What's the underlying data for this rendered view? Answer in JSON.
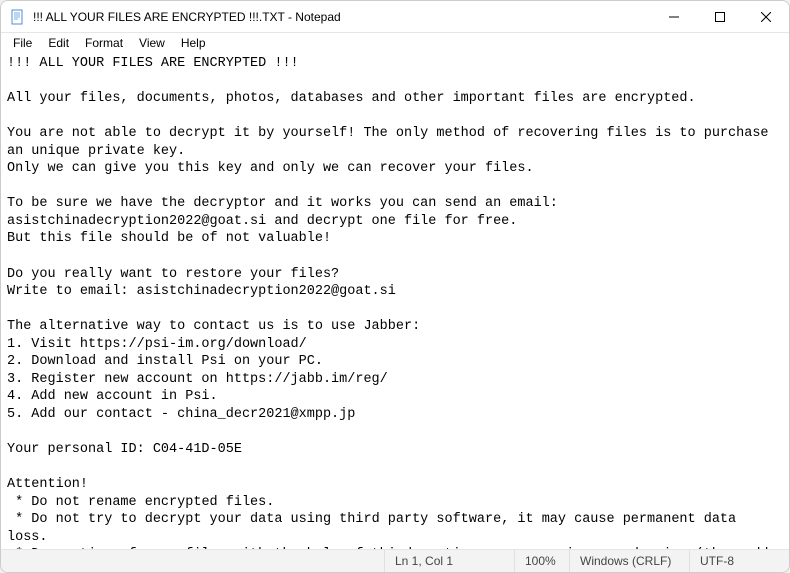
{
  "titlebar": {
    "title": "!!! ALL YOUR FILES ARE ENCRYPTED !!!.TXT - Notepad",
    "icon": "notepad-icon"
  },
  "menubar": {
    "file": "File",
    "edit": "Edit",
    "format": "Format",
    "view": "View",
    "help": "Help"
  },
  "content": {
    "text": "!!! ALL YOUR FILES ARE ENCRYPTED !!!\n\nAll your files, documents, photos, databases and other important files are encrypted.\n\nYou are not able to decrypt it by yourself! The only method of recovering files is to purchase an unique private key.\nOnly we can give you this key and only we can recover your files.\n\nTo be sure we have the decryptor and it works you can send an email: asistchinadecryption2022@goat.si and decrypt one file for free.\nBut this file should be of not valuable!\n\nDo you really want to restore your files?\nWrite to email: asistchinadecryption2022@goat.si\n\nThe alternative way to contact us is to use Jabber:\n1. Visit https://psi-im.org/download/\n2. Download and install Psi on your PC.\n3. Register new account on https://jabb.im/reg/\n4. Add new account in Psi.\n5. Add our contact - china_decr2021@xmpp.jp\n\nYour personal ID: C04-41D-05E\n\nAttention!\n * Do not rename encrypted files.\n * Do not try to decrypt your data using third party software, it may cause permanent data loss.\n * Decryption of your files with the help of third parties may cause increased price (they add their fee to our) or you can become a victim of a scam."
  },
  "statusbar": {
    "position": "Ln 1, Col 1",
    "zoom": "100%",
    "line_ending": "Windows (CRLF)",
    "encoding": "UTF-8"
  }
}
